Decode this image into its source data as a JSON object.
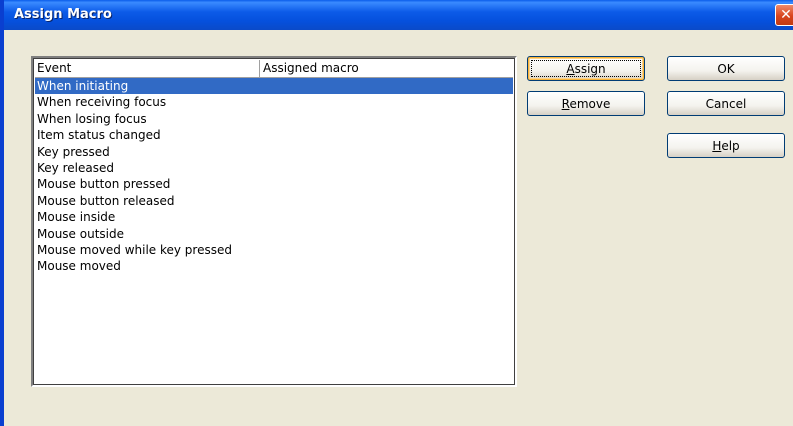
{
  "window": {
    "title": "Assign Macro",
    "close_glyph": "✕"
  },
  "list": {
    "columns": [
      "Event",
      "Assigned macro"
    ],
    "rows": [
      {
        "event": "When initiating",
        "macro": "",
        "selected": true
      },
      {
        "event": "When receiving focus",
        "macro": ""
      },
      {
        "event": "When losing focus",
        "macro": ""
      },
      {
        "event": "Item status changed",
        "macro": ""
      },
      {
        "event": "Key pressed",
        "macro": ""
      },
      {
        "event": "Key released",
        "macro": ""
      },
      {
        "event": "Mouse button pressed",
        "macro": ""
      },
      {
        "event": "Mouse button released",
        "macro": ""
      },
      {
        "event": "Mouse inside",
        "macro": ""
      },
      {
        "event": "Mouse outside",
        "macro": ""
      },
      {
        "event": "Mouse moved while key pressed",
        "macro": ""
      },
      {
        "event": "Mouse moved",
        "macro": ""
      }
    ]
  },
  "buttons": {
    "assign": {
      "label": "Assign",
      "mnemonic": "A"
    },
    "remove": {
      "label": "Remove",
      "mnemonic": "R"
    },
    "ok": {
      "label": "OK"
    },
    "cancel": {
      "label": "Cancel"
    },
    "help": {
      "label": "Help",
      "mnemonic": "H"
    }
  },
  "colors": {
    "selection": "#316AC5",
    "dialog_background": "#ECE9D8",
    "titlebar": "#0C5BE8"
  }
}
